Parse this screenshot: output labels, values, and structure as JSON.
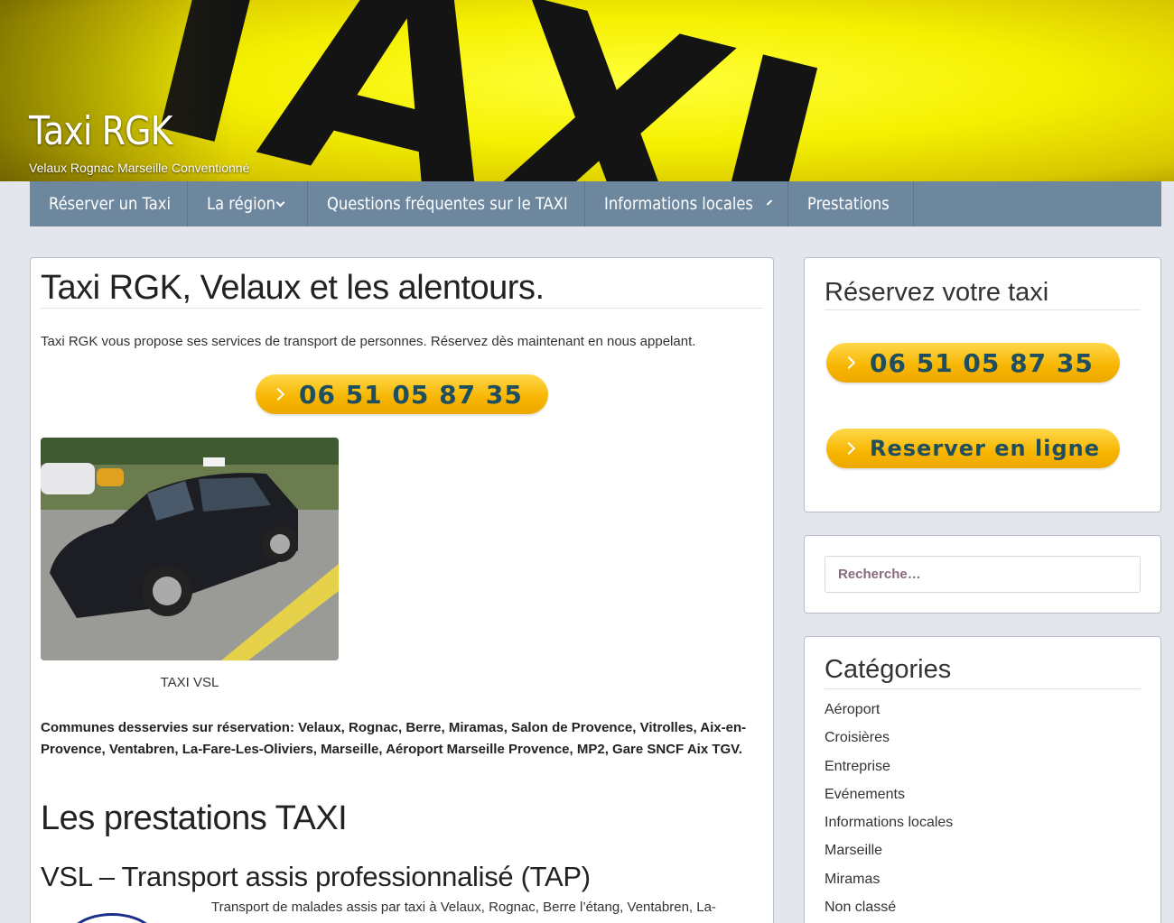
{
  "header": {
    "site_title": "Taxi RGK",
    "tagline": "Velaux Rognac Marseille Conventionné",
    "banner_text": "TAXI"
  },
  "nav": {
    "items": [
      {
        "label": "Réserver un Taxi",
        "has_dropdown": false
      },
      {
        "label": "La région",
        "has_dropdown": true
      },
      {
        "label": "Questions fréquentes sur le TAXI",
        "has_dropdown": false
      },
      {
        "label": "Informations locales",
        "has_dropdown": true
      },
      {
        "label": "Prestations",
        "has_dropdown": false
      }
    ]
  },
  "main": {
    "title": "Taxi RGK, Velaux et les alentours.",
    "intro": "Taxi RGK vous propose ses services de transport de personnes. Réservez dès maintenant en nous appelant.",
    "phone_button": "06 51 05 87 35",
    "photo_caption": "TAXI VSL",
    "communes": "Communes desservies sur réservation: Velaux, Rognac, Berre, Miramas, Salon de Provence, Vitrolles, Aix-en-Provence, Ventabren, La-Fare-Les-Oliviers, Marseille, Aéroport Marseille Provence, MP2, Gare SNCF Aix TGV.",
    "section_title": "Les prestations TAXI",
    "subsection_title": "VSL – Transport assis professionnalisé (TAP)",
    "vsl_text": "Transport de malades assis par taxi à Velaux, Rognac, Berre l’étang, Ventabren, La-"
  },
  "sidebar": {
    "reserve_widget": {
      "title": "Réservez votre taxi",
      "phone_button": "06 51 05 87 35",
      "online_button": "Reserver en ligne"
    },
    "search": {
      "placeholder": "Recherche…"
    },
    "categories": {
      "title": "Catégories",
      "items": [
        "Aéroport",
        "Croisières",
        "Entreprise",
        "Evénements",
        "Informations locales",
        "Marseille",
        "Miramas",
        "Non classé"
      ]
    }
  },
  "colors": {
    "nav_bg": "#6d889e",
    "page_bg": "#e4e6ee",
    "button_yellow": "#f7b500",
    "button_text": "#1f4e5e",
    "header_yellow": "#f5f000"
  }
}
